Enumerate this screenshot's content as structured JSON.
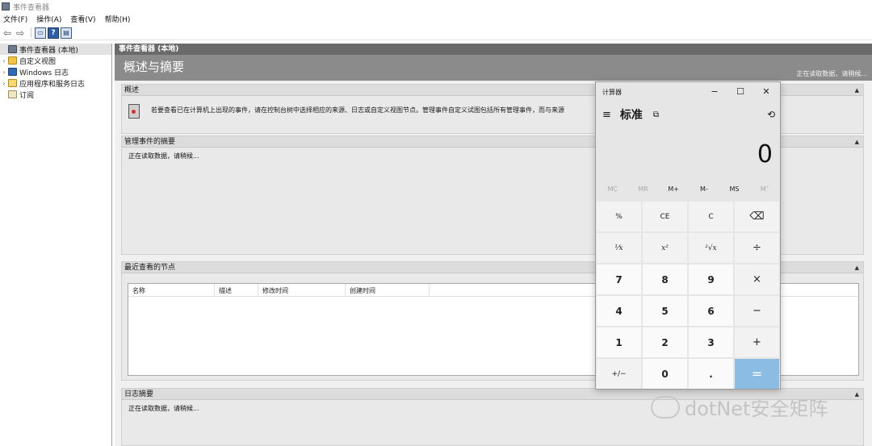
{
  "window": {
    "title": "事件查看器"
  },
  "menubar": {
    "items": [
      "文件(F)",
      "操作(A)",
      "查看(V)",
      "帮助(H)"
    ]
  },
  "toolbar": {
    "back": "⇦",
    "forward": "⇨",
    "help": "?"
  },
  "tree": {
    "items": [
      {
        "arrow": "",
        "label": "事件查看器 (本地)"
      },
      {
        "arrow": "›",
        "label": "自定义视图"
      },
      {
        "arrow": "›",
        "label": "Windows 日志"
      },
      {
        "arrow": "›",
        "label": "应用程序和服务日志"
      },
      {
        "arrow": "",
        "label": "订阅"
      }
    ]
  },
  "main": {
    "header": "事件查看器 (本地)",
    "subheader": "概述与摘要",
    "loading_status": "正在读取数据，请稍候...",
    "overview": {
      "title": "概述",
      "text": "若要查看已在计算机上出现的事件，请在控制台树中选择相应的来源、日志或自定义视图节点。管理事件自定义试图包括所有管理事件，而与来源"
    },
    "admin_summary": {
      "title": "管理事件的摘要",
      "text": "正在读取数据，请稍候..."
    },
    "recent_nodes": {
      "title": "最近查看的节点",
      "columns": [
        "名称",
        "描述",
        "修改时间",
        "创建时间"
      ]
    },
    "log_summary": {
      "title": "日志摘要",
      "text": "正在读取数据，请稍候..."
    }
  },
  "calculator": {
    "title": "计算器",
    "minimize": "−",
    "maximize": "☐",
    "close": "✕",
    "menu": "≡",
    "mode": "标准",
    "keep_on_top": "⧉",
    "history": "⟲",
    "display": "0",
    "memory": [
      "MC",
      "MR",
      "M+",
      "M-",
      "MS",
      "M˅"
    ],
    "keys": [
      "%",
      "CE",
      "C",
      "⌫",
      "⅟x",
      "x²",
      "²√x",
      "÷",
      "7",
      "8",
      "9",
      "×",
      "4",
      "5",
      "6",
      "−",
      "1",
      "2",
      "3",
      "+",
      "+/−",
      "0",
      ".",
      "="
    ]
  },
  "watermark": {
    "text": "dotNet安全矩阵"
  }
}
